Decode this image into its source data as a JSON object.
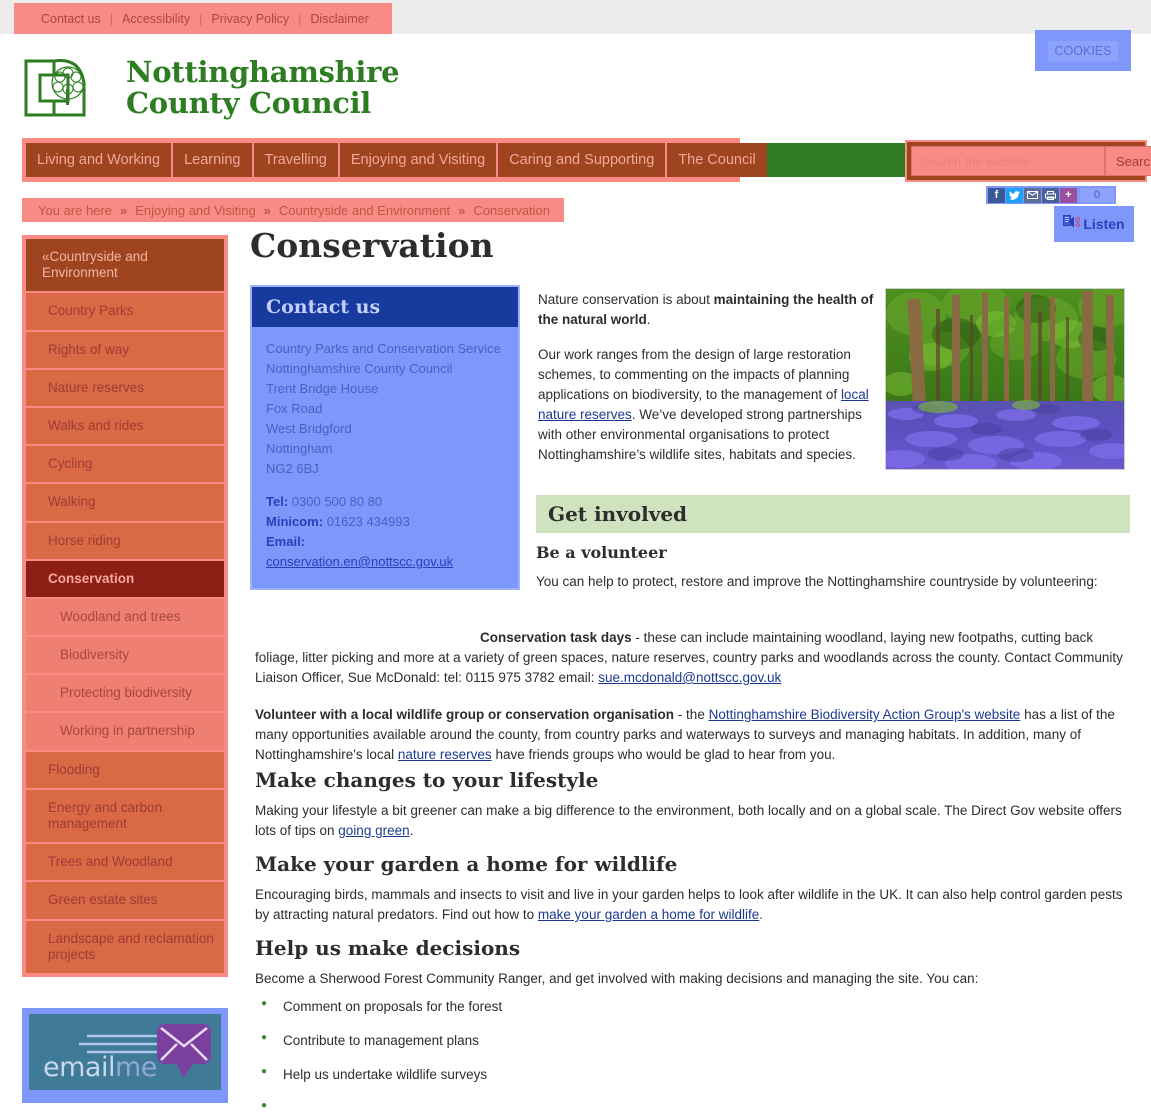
{
  "topbar": {
    "links": [
      "Contact us",
      "Accessibility",
      "Privacy Policy",
      "Disclaimer"
    ],
    "separator": "|",
    "cookies_label": "COOKIES"
  },
  "logo": {
    "line1": "Nottinghamshire",
    "line2": "County Council",
    "icon": "oak-tree-logo",
    "color": "#2e7d23"
  },
  "nav": {
    "items": [
      "Living and Working",
      "Learning",
      "Travelling",
      "Enjoying and Visiting",
      "Caring and Supporting",
      "The Council"
    ]
  },
  "search": {
    "placeholder": "Search the website",
    "value": "",
    "button_label": "Search"
  },
  "social": {
    "icons": [
      "facebook-icon",
      "twitter-icon",
      "email-icon",
      "print-icon",
      "share-plus-icon"
    ],
    "glyphs": [
      "f",
      "ᴠ",
      "✉",
      "⎙",
      "+"
    ],
    "count": "0"
  },
  "listen": {
    "label": "Listen",
    "icon": "speaker-icon"
  },
  "breadcrumb": {
    "prefix": "You are here",
    "arrow": "»",
    "items": [
      "Enjoying and Visiting",
      "Countryside and Environment",
      "Conservation"
    ]
  },
  "sidebar": {
    "header": "«Countryside and Environment",
    "items": [
      {
        "label": "Country Parks",
        "type": "item"
      },
      {
        "label": "Rights of way",
        "type": "item"
      },
      {
        "label": "Nature reserves",
        "type": "item"
      },
      {
        "label": "Walks and rides",
        "type": "item"
      },
      {
        "label": "Cycling",
        "type": "item"
      },
      {
        "label": "Walking",
        "type": "item"
      },
      {
        "label": "Horse riding",
        "type": "item"
      },
      {
        "label": "Conservation",
        "type": "active"
      },
      {
        "label": "Woodland and trees",
        "type": "sub"
      },
      {
        "label": "Biodiversity",
        "type": "sub"
      },
      {
        "label": "Protecting biodiversity",
        "type": "sub"
      },
      {
        "label": "Working in partnership",
        "type": "sub"
      },
      {
        "label": "Flooding",
        "type": "item"
      },
      {
        "label": "Energy and carbon management",
        "type": "item"
      },
      {
        "label": "Trees and Woodland",
        "type": "item"
      },
      {
        "label": "Green estate sites",
        "type": "item"
      },
      {
        "label": "Landscape and reclamation projects",
        "type": "item"
      }
    ]
  },
  "emailme": {
    "text_email": "email",
    "text_me": "me",
    "icon": "envelope-icon"
  },
  "main": {
    "page_title": "Conservation",
    "contact": {
      "heading": "Contact us",
      "address": [
        "Country Parks and Conservation Service",
        "Nottinghamshire County Council",
        "Trent Bridge House",
        "Fox Road",
        "West Bridgford",
        "Nottingham",
        "NG2 6BJ"
      ],
      "tel_label": "Tel:",
      "tel_value": "0300 500 80 80",
      "minicom_label": "Minicom:",
      "minicom_value": "01623 434993",
      "email_label": "Email:",
      "email_value": "conservation.en@nottscc.gov.uk"
    },
    "intro": {
      "p1_a": "Nature conservation is about ",
      "p1_bold": "maintaining the health of the natural world",
      "p1_b": ".",
      "p2_a": "Our work ranges from the design of large restoration schemes, to commenting on the impacts of planning applications on biodiversity, to the management of ",
      "p2_link": "local nature reserves",
      "p2_b": ". We’ve developed strong partnerships with other environmental organisations to protect Nottinghamshire’s wildlife sites, habitats and species."
    },
    "hero_image_alt": "bluebell-woodland-photo",
    "get_involved_heading": "Get involved",
    "volunteer": {
      "heading": "Be a volunteer",
      "intro": "You can help to protect, restore and improve the Nottinghamshire countryside by volunteering:",
      "task_days_bold": "Conservation task days",
      "task_days_text": " - these can include maintaining woodland, laying new footpaths, cutting back foliage, litter picking and more at a variety of green spaces, nature reserves, country parks and woodlands across the county. Contact Community Liaison Officer, Sue McDonald: tel: 0115 975 3782 email: ",
      "task_days_email": "sue.mcdonald@nottscc.gov.uk",
      "wildlife_bold": "Volunteer with a local wildlife group or conservation organisation",
      "wildlife_a": "  - the ",
      "wildlife_link": "Nottinghamshire Biodiversity Action Group's website",
      "wildlife_b": " has a list of the many opportunities available around the county, from country parks and waterways to surveys and managing habitats. In addition, many of Nottinghamshire's local ",
      "wildlife_link2": "nature reserves",
      "wildlife_c": " have friends groups who would be glad to hear from you."
    },
    "lifestyle": {
      "heading": "Make changes to your lifestyle",
      "text_a": "Making your lifestyle a bit greener can make a big difference to the environment, both locally and on a global scale. The Direct Gov website offers lots of tips on ",
      "link": "going green",
      "text_b": "."
    },
    "garden": {
      "heading": "Make your garden a home for wildlife",
      "text_a": "Encouraging birds, mammals and insects to visit and live in your garden helps to look after wildlife in the UK. It can also help control garden pests by attracting natural predators. Find out how to ",
      "link": "make your garden a home for wildlife",
      "text_b": "."
    },
    "decisions": {
      "heading": "Help us make decisions",
      "intro": "Become a Sherwood Forest Community Ranger, and get involved with making decisions and managing the site. You can:",
      "bullets": [
        "Comment on proposals for the forest",
        "Contribute to management plans",
        "Help us undertake wildlife surveys",
        ""
      ]
    }
  },
  "colors": {
    "brand_green": "#2e7d23",
    "nav_brown": "#9e4520",
    "salmon": "#f98b84",
    "active_red": "#8c1e16",
    "contact_blue": "#7e97fb",
    "contact_head_blue": "#173a9e",
    "get_involved_green": "#cfe3bf",
    "link_blue": "#1b3a8f"
  }
}
